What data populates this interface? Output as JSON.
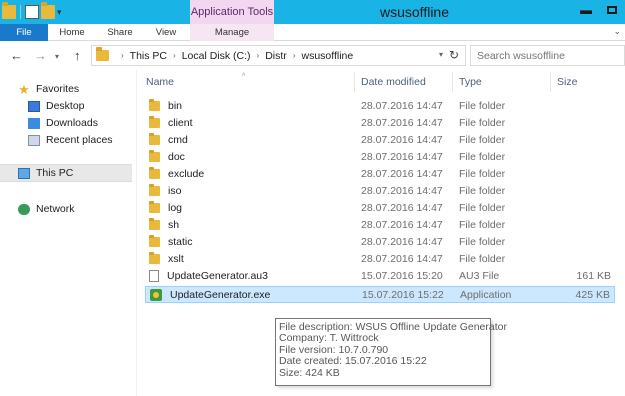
{
  "window": {
    "title": "wsusoffline"
  },
  "ribbon": {
    "context_group": "Application Tools",
    "tabs": [
      "File",
      "Home",
      "Share",
      "View",
      "Manage"
    ]
  },
  "address": {
    "crumbs": [
      "This PC",
      "Local Disk (C:)",
      "Distr",
      "wsusoffline"
    ]
  },
  "search": {
    "placeholder": "Search wsusoffline"
  },
  "navpane": {
    "items": [
      "Favorites",
      "Desktop",
      "Downloads",
      "Recent places",
      "This PC",
      "Network"
    ]
  },
  "columns": {
    "name": "Name",
    "date": "Date modified",
    "type": "Type",
    "size": "Size"
  },
  "files": [
    {
      "name": "bin",
      "date": "28.07.2016 14:47",
      "type": "File folder",
      "size": "",
      "icon": "folder"
    },
    {
      "name": "client",
      "date": "28.07.2016 14:47",
      "type": "File folder",
      "size": "",
      "icon": "folder"
    },
    {
      "name": "cmd",
      "date": "28.07.2016 14:47",
      "type": "File folder",
      "size": "",
      "icon": "folder"
    },
    {
      "name": "doc",
      "date": "28.07.2016 14:47",
      "type": "File folder",
      "size": "",
      "icon": "folder"
    },
    {
      "name": "exclude",
      "date": "28.07.2016 14:47",
      "type": "File folder",
      "size": "",
      "icon": "folder"
    },
    {
      "name": "iso",
      "date": "28.07.2016 14:47",
      "type": "File folder",
      "size": "",
      "icon": "folder"
    },
    {
      "name": "log",
      "date": "28.07.2016 14:47",
      "type": "File folder",
      "size": "",
      "icon": "folder"
    },
    {
      "name": "sh",
      "date": "28.07.2016 14:47",
      "type": "File folder",
      "size": "",
      "icon": "folder"
    },
    {
      "name": "static",
      "date": "28.07.2016 14:47",
      "type": "File folder",
      "size": "",
      "icon": "folder"
    },
    {
      "name": "xslt",
      "date": "28.07.2016 14:47",
      "type": "File folder",
      "size": "",
      "icon": "folder"
    },
    {
      "name": "UpdateGenerator.au3",
      "date": "15.07.2016 15:20",
      "type": "AU3 File",
      "size": "161 KB",
      "icon": "au3"
    },
    {
      "name": "UpdateGenerator.exe",
      "date": "15.07.2016 15:22",
      "type": "Application",
      "size": "425 KB",
      "icon": "exe"
    }
  ],
  "tooltip": {
    "lines": [
      "File description: WSUS Offline Update Generator",
      "Company: T. Wittrock",
      "File version: 10.7.0.790",
      "Date created: 15.07.2016 15:22",
      "Size: 424 KB"
    ]
  },
  "colors": {
    "titlebar": "#19b3e6",
    "file_tab": "#1979ca",
    "context_tab": "#f3d7f0",
    "selection": "#cce8ff"
  }
}
